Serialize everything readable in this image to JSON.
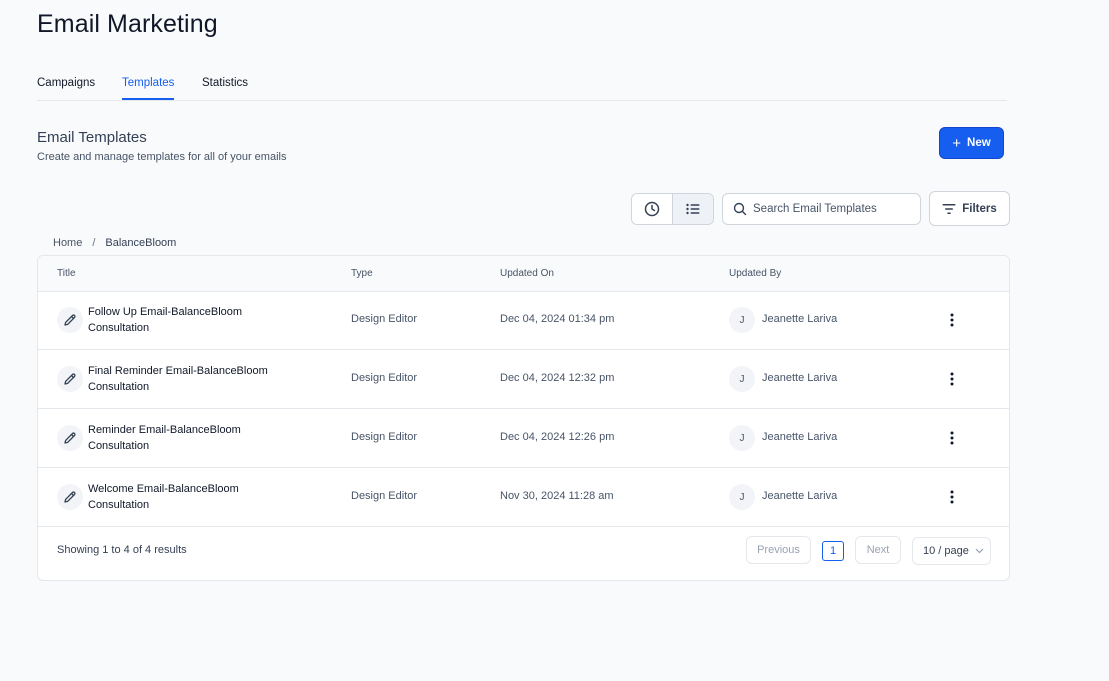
{
  "page": {
    "title": "Email Marketing"
  },
  "tabs": [
    {
      "label": "Campaigns",
      "active": false
    },
    {
      "label": "Templates",
      "active": true
    },
    {
      "label": "Statistics",
      "active": false
    }
  ],
  "section": {
    "title": "Email Templates",
    "subtitle": "Create and manage templates for all of your emails",
    "new_label": "New"
  },
  "toolbar": {
    "search_placeholder": "Search Email Templates",
    "filters_label": "Filters"
  },
  "breadcrumb": {
    "home": "Home",
    "separator": "/",
    "current": "BalanceBloom"
  },
  "table": {
    "columns": [
      "Title",
      "Type",
      "Updated On",
      "Updated By"
    ],
    "rows": [
      {
        "title": "Follow Up Email-BalanceBloom Consultation",
        "type": "Design Editor",
        "updated_on": "Dec 04, 2024 01:34 pm",
        "initial": "J",
        "updated_by": "Jeanette Lariva"
      },
      {
        "title": "Final Reminder Email-BalanceBloom Consultation",
        "type": "Design Editor",
        "updated_on": "Dec 04, 2024 12:32 pm",
        "initial": "J",
        "updated_by": "Jeanette Lariva"
      },
      {
        "title": "Reminder Email-BalanceBloom Consultation",
        "type": "Design Editor",
        "updated_on": "Dec 04, 2024 12:26 pm",
        "initial": "J",
        "updated_by": "Jeanette Lariva"
      },
      {
        "title": "Welcome Email-BalanceBloom Consultation",
        "type": "Design Editor",
        "updated_on": "Nov 30, 2024 11:28 am",
        "initial": "J",
        "updated_by": "Jeanette Lariva"
      }
    ]
  },
  "pagination": {
    "summary": "Showing 1 to 4 of 4 results",
    "previous": "Previous",
    "current_page": "1",
    "next": "Next",
    "per_page": "10 / page"
  },
  "colors": {
    "accent": "#155eef",
    "text": "#101828",
    "muted": "#475467",
    "border": "#e4e7ec",
    "background": "#f9fafb"
  },
  "icons": {
    "new": "plus-icon",
    "recent": "clock-icon",
    "list": "list-icon",
    "search": "search-icon",
    "filters": "filter-icon",
    "row_edit": "pencil-icon",
    "row_menu": "more-vertical-icon",
    "per_page": "chevron-down-icon"
  }
}
